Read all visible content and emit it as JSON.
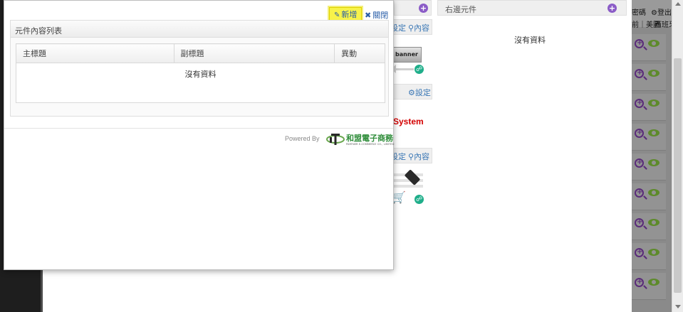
{
  "modal": {
    "add_label": "新增",
    "close_label": "關閉",
    "panel_title": "元件內容列表",
    "table": {
      "columns": [
        "主標題",
        "副標題",
        "異動"
      ],
      "empty_text": "沒有資料"
    },
    "footer": {
      "powered_by": "Powered By",
      "brand_name": "和盟電子商務",
      "brand_sub": "PARTNER E-COMMERCE CO., LIMITED"
    }
  },
  "background": {
    "right_panel_title": "右邊元件",
    "right_panel_empty": "沒有資料",
    "links": {
      "settings_1": "設定",
      "content_1": "內容",
      "settings_2": "設定",
      "settings_3": "設定",
      "content_3": "內容"
    },
    "banner_label": "banner",
    "system_text": "System",
    "top_right": {
      "password_label": "密碼",
      "logout_label": "登出",
      "nav_text": "前｜美圖",
      "nav_text2": "西班牙"
    },
    "row_count": 9
  },
  "colors": {
    "highlight": "#f7f34a",
    "link": "#2a5ea8",
    "brand_green": "#2f8d3a",
    "accent_purple": "#8b5cc7",
    "badge_green": "#1fae8a"
  },
  "icons": {
    "add": "pencil-icon",
    "close": "times-icon",
    "plus": "plus-circle-icon",
    "zoom": "zoom-in-icon",
    "view": "eye-icon",
    "settings": "gear-icon"
  }
}
